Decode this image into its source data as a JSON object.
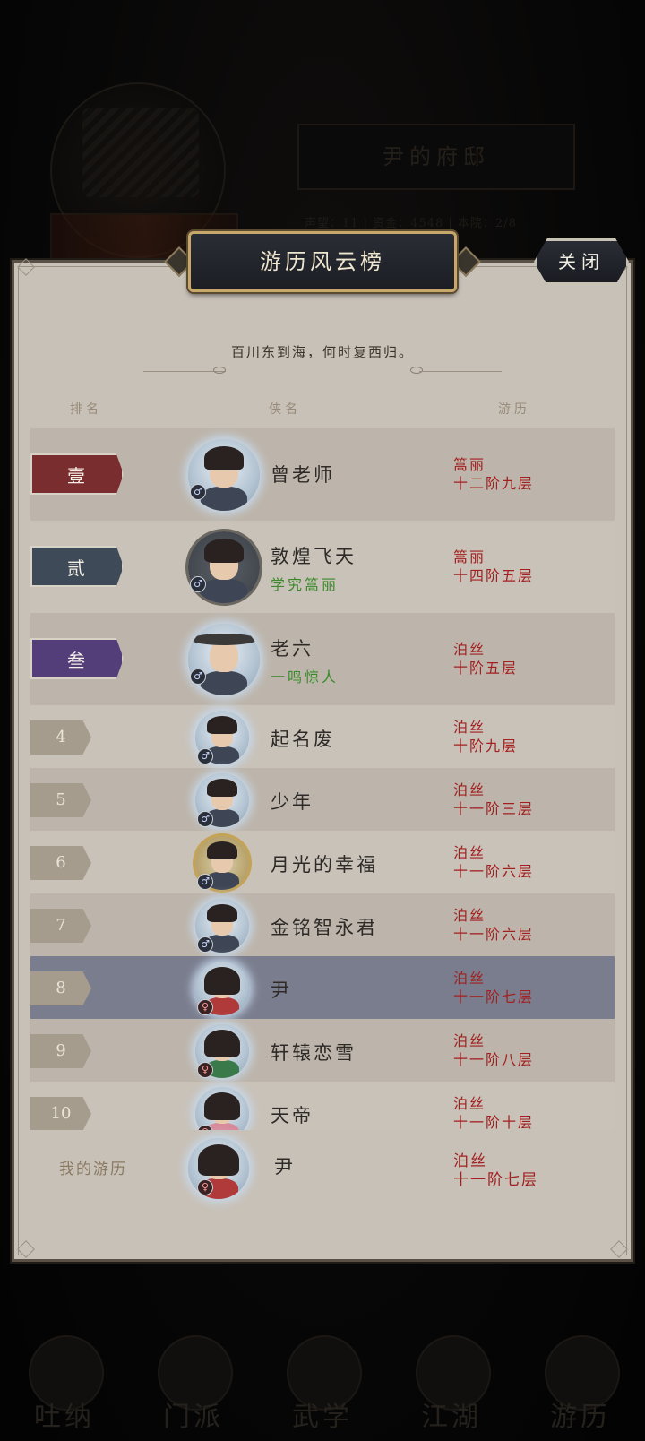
{
  "background": {
    "residence_title": "尹的府邸",
    "stats_text": "声望：11 | 资金：4548 | 本院：2/8",
    "nav": [
      {
        "label": "吐纳",
        "icon": "meditation-icon"
      },
      {
        "label": "门派",
        "icon": "sect-icon"
      },
      {
        "label": "武学",
        "icon": "martial-arts-icon"
      },
      {
        "label": "江湖",
        "icon": "jianghu-icon"
      },
      {
        "label": "游历",
        "icon": "travel-icon"
      }
    ]
  },
  "dialog": {
    "title": "游历风云榜",
    "close_label": "关闭",
    "subtitle": "百川东到海，何时复西归。",
    "headers": {
      "rank": "排名",
      "name": "侠名",
      "realm": "游历"
    }
  },
  "leaderboard": [
    {
      "rank": "壹",
      "name": "曾老师",
      "title": "",
      "realm1": "篙丽",
      "realm2": "十二阶九层",
      "gender": "♂"
    },
    {
      "rank": "贰",
      "name": "敦煌飞天",
      "title": "学究篙丽",
      "realm1": "篙丽",
      "realm2": "十四阶五层",
      "gender": "♂"
    },
    {
      "rank": "叁",
      "name": "老六",
      "title": "一鸣惊人",
      "realm1": "泊丝",
      "realm2": "十阶五层",
      "gender": "♂"
    },
    {
      "rank": "4",
      "name": "起名废",
      "realm1": "泊丝",
      "realm2": "十阶九层",
      "gender": "♂"
    },
    {
      "rank": "5",
      "name": "少年",
      "realm1": "泊丝",
      "realm2": "十一阶三层",
      "gender": "♂"
    },
    {
      "rank": "6",
      "name": "月光的幸福",
      "realm1": "泊丝",
      "realm2": "十一阶六层",
      "gender": "♂"
    },
    {
      "rank": "7",
      "name": "金铭智永君",
      "realm1": "泊丝",
      "realm2": "十一阶六层",
      "gender": "♂"
    },
    {
      "rank": "8",
      "name": "尹",
      "realm1": "泊丝",
      "realm2": "十一阶七层",
      "gender": "♀"
    },
    {
      "rank": "9",
      "name": "轩辕恋雪",
      "realm1": "泊丝",
      "realm2": "十一阶八层",
      "gender": "♀"
    },
    {
      "rank": "10",
      "name": "天帝",
      "realm1": "泊丝",
      "realm2": "十一阶十层",
      "gender": "♀"
    }
  ],
  "mine": {
    "label": "我的游历",
    "name": "尹",
    "realm1": "泊丝",
    "realm2": "十一阶七层",
    "gender": "♀"
  }
}
